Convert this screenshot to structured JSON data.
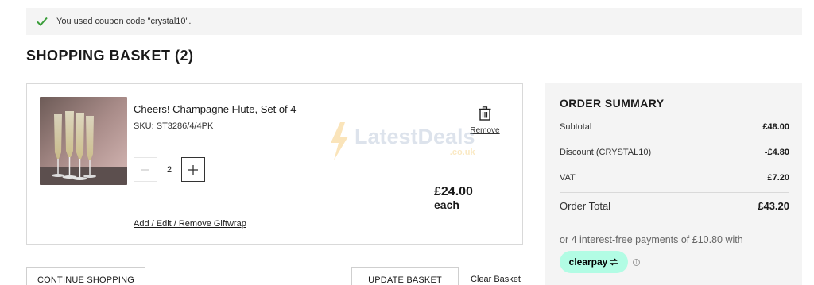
{
  "notice": {
    "message": "You used coupon code \"crystal10\"."
  },
  "page": {
    "title": "SHOPPING BASKET (2)"
  },
  "item": {
    "name": "Cheers! Champagne Flute, Set of 4",
    "sku": "SKU: ST3286/4/4PK",
    "quantity": "2",
    "remove_label": "Remove",
    "price": "£24.00",
    "price_unit": "each",
    "giftwrap_label": "Add / Edit / Remove Giftwrap"
  },
  "watermark": {
    "text": "LatestDeals",
    "sub": ".co.uk"
  },
  "summary": {
    "title": "ORDER SUMMARY",
    "rows": [
      {
        "label": "Subtotal",
        "value": "£48.00"
      },
      {
        "label": "Discount (CRYSTAL10)",
        "value": "-£4.80"
      },
      {
        "label": "VAT",
        "value": "£7.20"
      }
    ],
    "total_label": "Order Total",
    "total_value": "£43.20",
    "pay_later": "or 4 interest-free payments of £10.80 with",
    "clearpay_label": "clearpay"
  },
  "actions": {
    "continue_label": "CONTINUE SHOPPING",
    "update_label": "UPDATE BASKET",
    "clear_label": "Clear Basket"
  },
  "colors": {
    "success_green": "#3a9d3a",
    "clearpay_mint": "#b2fce4",
    "panel_gray": "#f4f4f4"
  },
  "icons": {
    "notice": "checkmark-icon",
    "remove": "trash-icon",
    "minus": "minus-icon",
    "plus": "plus-icon",
    "info": "info-icon"
  }
}
